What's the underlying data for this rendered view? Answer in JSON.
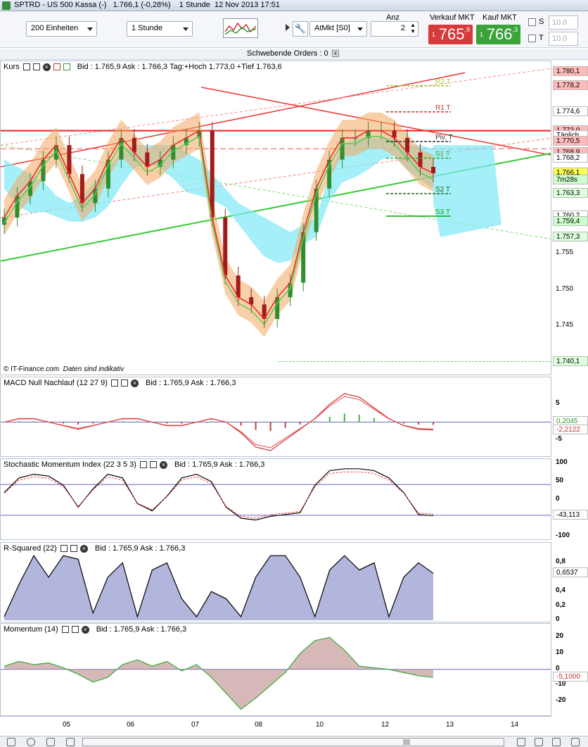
{
  "window": {
    "title": "SPTRD - US 500 Kassa (-)",
    "last": "1.766,1",
    "change": "(-0,28%)",
    "interval": "1 Stunde",
    "datetime": "12 Nov 2013 17:51"
  },
  "toolbar": {
    "units": "200 Einheiten",
    "period": "1 Stunde",
    "ordertype": "AtMkt [S0]",
    "anz_label": "Anz",
    "anz_value": "2",
    "sell_label": "Verkauf MKT",
    "buy_label": "Kauf MKT",
    "sell_pre": "1",
    "sell_big": "765",
    "sell_dec": "9",
    "buy_pre": "1",
    "buy_big": "766",
    "buy_dec": "3",
    "s_label": "S",
    "t_label": "T",
    "s_value": "10.0",
    "t_value": "10.0"
  },
  "pending": "Schwebende Orders : 0",
  "colors": {
    "bull": "#2f8f2f",
    "bear": "#a31c1c",
    "buybox": "#3aa33a",
    "sellbox": "#d63a3a",
    "cloud_cyan": "#7fe8f7",
    "cloud_green": "#8be08a",
    "band": "#f2a860"
  },
  "panels": {
    "price": {
      "title": "Kurs",
      "bidask": "Bid : 1.765,9 Ask : 1.766,3 Tag:+Hoch 1.773,0 +Tief 1.763,6",
      "copyright": "© IT-Finance.com",
      "disclaimer": "Daten sind indikativ"
    },
    "macd": {
      "title": "MACD Null Nachlauf (12 27 9)",
      "bidask": "Bid : 1.765,9 Ask : 1.766,3"
    },
    "stoch": {
      "title": "Stochastic Momentum Index (22 3 5 3)",
      "bidask": "Bid : 1.765,9 Ask : 1.766,3"
    },
    "rsq": {
      "title": "R-Squared (22)",
      "bidask": "Bid : 1.765,9 Ask : 1.766,3"
    },
    "mom": {
      "title": "Momentum (14)",
      "bidask": "Bid : 1.765,9 Ask : 1.766,3"
    }
  },
  "chart_data": [
    {
      "type": "line",
      "panel": "price",
      "title": "Kurs",
      "x_labels": [
        "05",
        "06",
        "07",
        "08",
        "10",
        "12",
        "13",
        "14"
      ],
      "yticks": [
        "1.755",
        "1.750",
        "1.745"
      ],
      "price_tags": [
        "1.780,1",
        "1.778,2",
        "1.774,6",
        "1.772,0",
        "Täglich",
        "1.770,5",
        "1.768,9",
        "1.768,2",
        "1.766,1",
        "7m28s",
        "1.763,3",
        "1.760,2",
        "1.759,4",
        "1.757,3",
        "1.740,1"
      ],
      "pivots": [
        {
          "name": "R2 T",
          "value": 1778.2
        },
        {
          "name": "R1 T",
          "value": 1774.6
        },
        {
          "name": "Piv. T",
          "value": 1770.5
        },
        {
          "name": "S1 T",
          "value": 1768.2
        },
        {
          "name": "S2 T",
          "value": 1763.3
        },
        {
          "name": "S3 T",
          "value": 1760.2
        }
      ],
      "close_approx": [
        1760,
        1763,
        1765,
        1768,
        1770,
        1766,
        1762,
        1764,
        1768,
        1771,
        1769,
        1767,
        1768,
        1770,
        1771,
        1772,
        1760,
        1752,
        1749,
        1748,
        1746,
        1749,
        1751,
        1758,
        1764,
        1768,
        1771,
        1771,
        1772,
        1772,
        1771,
        1769,
        1767,
        1766.1
      ]
    },
    {
      "type": "line",
      "panel": "macd",
      "title": "MACD Null Nachlauf (12 27 9)",
      "yticks": [
        "5",
        "0",
        "-5"
      ],
      "last": [
        0.2045,
        -2.2122
      ]
    },
    {
      "type": "line",
      "panel": "stoch",
      "title": "Stochastic Momentum Index (22 3 5 3)",
      "yticks": [
        "100",
        "50",
        "0",
        "-50",
        "-100"
      ],
      "last": -43.113,
      "values": [
        20,
        60,
        70,
        65,
        40,
        -20,
        30,
        70,
        60,
        -10,
        -30,
        10,
        60,
        70,
        50,
        -20,
        -50,
        -55,
        -45,
        -40,
        -35,
        40,
        80,
        85,
        85,
        80,
        60,
        20,
        -40,
        -43.1
      ]
    },
    {
      "type": "area",
      "panel": "rsq",
      "title": "R-Squared (22)",
      "yticks": [
        "0,8",
        "0,4",
        "0,2",
        "0"
      ],
      "last": 0.6537,
      "values": [
        0.05,
        0.5,
        0.9,
        0.6,
        0.9,
        0.85,
        0.1,
        0.6,
        0.8,
        0.05,
        0.7,
        0.8,
        0.3,
        0.05,
        0.4,
        0.3,
        0.05,
        0.6,
        0.9,
        0.9,
        0.6,
        0.05,
        0.7,
        0.9,
        0.7,
        0.8,
        0.05,
        0.6,
        0.8,
        0.6537
      ]
    },
    {
      "type": "area",
      "panel": "mom",
      "title": "Momentum (14)",
      "yticks": [
        "20",
        "10",
        "0",
        "-10",
        "-20"
      ],
      "last": -5.1,
      "values": [
        2,
        5,
        3,
        4,
        1,
        -3,
        -8,
        -5,
        3,
        6,
        2,
        5,
        -1,
        3,
        -5,
        -15,
        -25,
        -18,
        -10,
        -2,
        10,
        18,
        20,
        12,
        2,
        1,
        0,
        -2,
        -4,
        -5.1
      ]
    }
  ]
}
